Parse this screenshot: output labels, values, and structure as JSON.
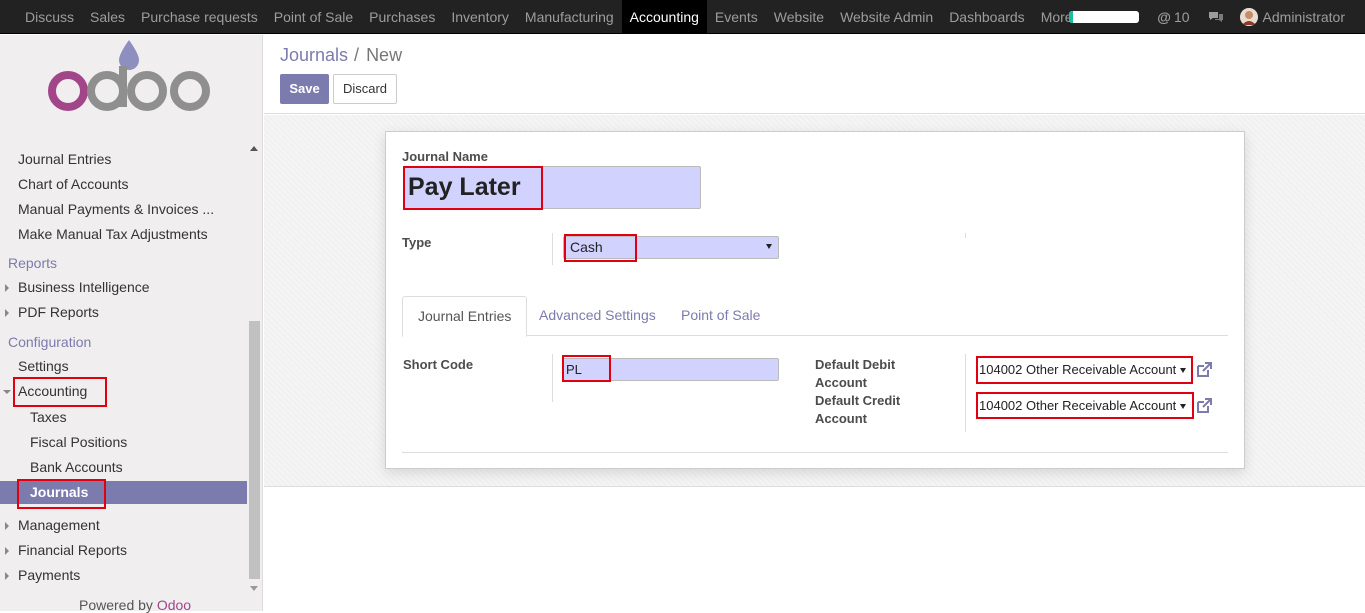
{
  "topbar": {
    "menu": [
      "Discuss",
      "Sales",
      "Purchase requests",
      "Point of Sale",
      "Purchases",
      "Inventory",
      "Manufacturing",
      "Accounting",
      "Events",
      "Website",
      "Website Admin",
      "Dashboards",
      "More"
    ],
    "active_item": "Accounting",
    "mentions_count": "10",
    "user": "Administrator",
    "progress_fraction": 0.05
  },
  "sidebar": {
    "items": [
      {
        "label": "Journal Entries",
        "kind": "item"
      },
      {
        "label": "Chart of Accounts",
        "kind": "item"
      },
      {
        "label": "Manual Payments & Invoices ...",
        "kind": "item"
      },
      {
        "label": "Make Manual Tax Adjustments",
        "kind": "item"
      },
      {
        "label": "Reports",
        "kind": "head"
      },
      {
        "label": "Business Intelligence",
        "kind": "collapsed"
      },
      {
        "label": "PDF Reports",
        "kind": "collapsed"
      },
      {
        "label": "Configuration",
        "kind": "head"
      },
      {
        "label": "Settings",
        "kind": "item"
      },
      {
        "label": "Accounting",
        "kind": "expanded"
      },
      {
        "label": "Taxes",
        "kind": "sub"
      },
      {
        "label": "Fiscal Positions",
        "kind": "sub"
      },
      {
        "label": "Bank Accounts",
        "kind": "sub"
      },
      {
        "label": "Journals",
        "kind": "selected"
      },
      {
        "label": "Management",
        "kind": "collapsed"
      },
      {
        "label": "Financial Reports",
        "kind": "collapsed"
      },
      {
        "label": "Payments",
        "kind": "collapsed"
      }
    ],
    "powered_prefix": "Powered by",
    "powered_brand": "Odoo"
  },
  "breadcrumb": {
    "parent": "Journals",
    "sep": "/",
    "current": "New"
  },
  "buttons": {
    "save": "Save",
    "discard": "Discard"
  },
  "form": {
    "journal_name_label": "Journal Name",
    "journal_name_value": "Pay Later",
    "type_label": "Type",
    "type_value": "Cash",
    "tabs": [
      "Journal Entries",
      "Advanced Settings",
      "Point of Sale"
    ],
    "active_tab": "Journal Entries",
    "short_code_label": "Short Code",
    "short_code_value": "PL",
    "default_debit_label_1": "Default Debit",
    "default_debit_label_2": "Account",
    "default_debit_value": "104002 Other Receivable Account",
    "default_credit_label_1": "Default Credit",
    "default_credit_label_2": "Account",
    "default_credit_value": "104002 Other Receivable Account"
  },
  "colors": {
    "brand": "#7c7bad",
    "annotation": "#e0000f",
    "input_required": "#d2d2ff",
    "odoo_purple": "#a24689"
  }
}
